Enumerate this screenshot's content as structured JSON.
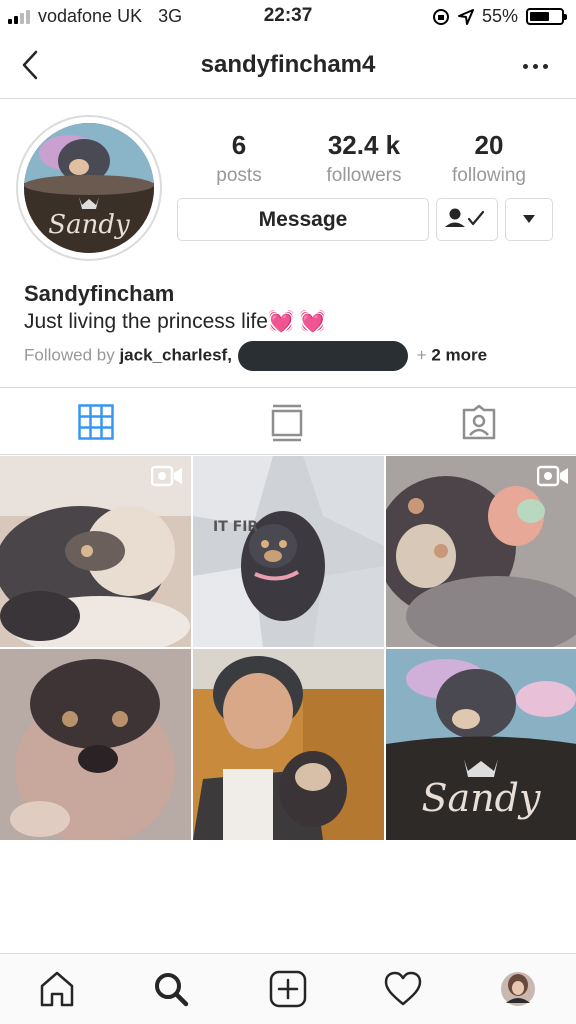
{
  "status_bar": {
    "carrier": "vodafone UK",
    "network": "3G",
    "time": "22:37",
    "battery": "55%",
    "battery_level": 0.55
  },
  "nav": {
    "username": "sandyfincham4",
    "back_icon": "chevron-left-icon",
    "more_icon": "ellipsis-icon"
  },
  "profile": {
    "avatar_text": "Sandy",
    "stats": [
      {
        "value": "6",
        "label": "posts"
      },
      {
        "value": "32.4 k",
        "label": "followers"
      },
      {
        "value": "20",
        "label": "following"
      }
    ],
    "message_button": "Message",
    "display_name": "Sandyfincham",
    "bio": "Just living the princess life",
    "bio_emoji": "💓 💓",
    "followed_by_prefix": "Followed by",
    "followed_by_user": "jack_charlesf,",
    "followed_more_plus": "+",
    "followed_more": "2 more"
  },
  "tabs": [
    {
      "icon": "grid-icon",
      "active": true
    },
    {
      "icon": "feed-icon",
      "active": false
    },
    {
      "icon": "tagged-icon",
      "active": false
    }
  ],
  "posts": [
    {
      "type": "video",
      "subject": "puppy-sleeping"
    },
    {
      "type": "photo",
      "subject": "puppy-on-wrapping"
    },
    {
      "type": "video",
      "subject": "puppy-with-toy"
    },
    {
      "type": "photo",
      "subject": "puppy-closeup"
    },
    {
      "type": "photo",
      "subject": "man-holding-puppy"
    },
    {
      "type": "photo",
      "subject": "puppy-in-bed",
      "overlay_text": "Sandy"
    }
  ],
  "bottom_bar": [
    "home-icon",
    "search-icon",
    "add-icon",
    "heart-icon",
    "profile-avatar"
  ],
  "colors": {
    "accent": "#3897f0",
    "text": "#262626",
    "muted": "#999999",
    "border": "#dbdbdb"
  }
}
